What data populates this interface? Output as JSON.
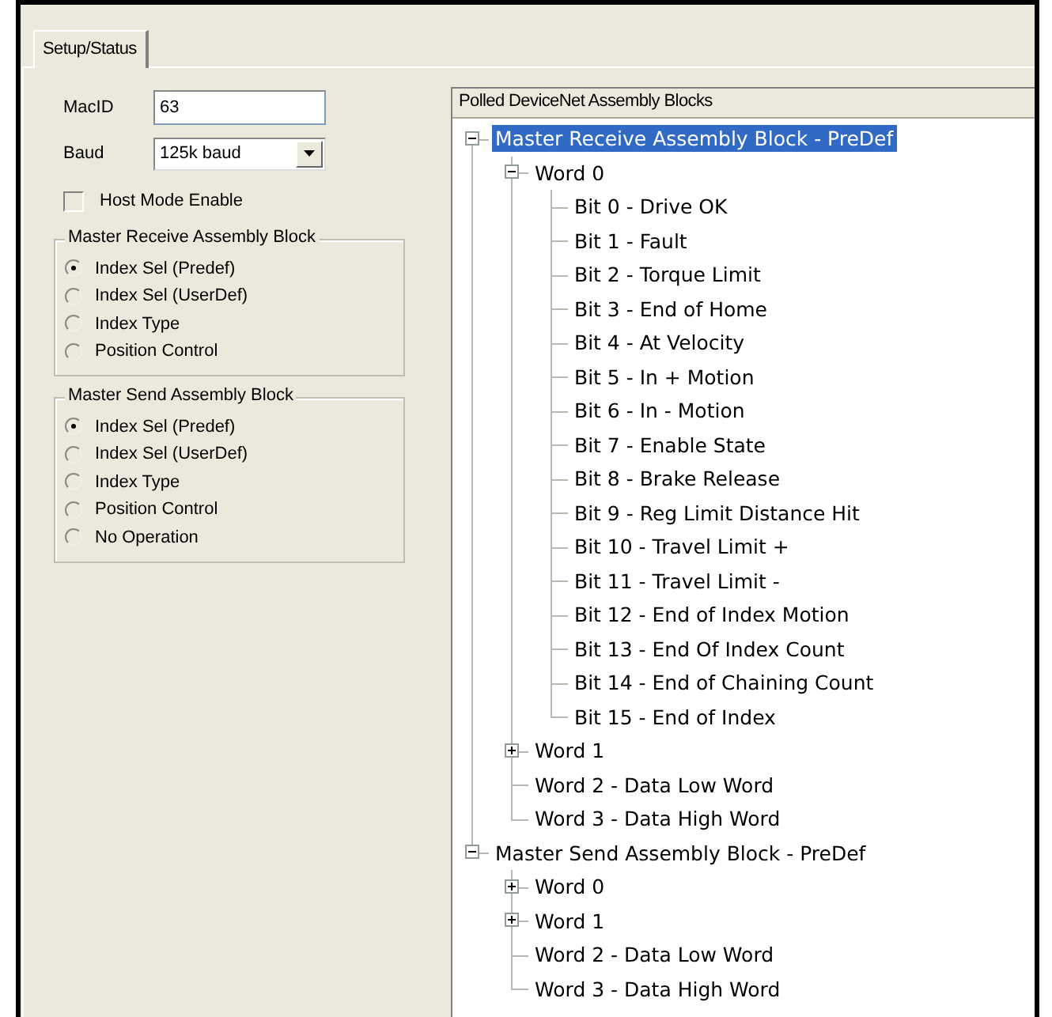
{
  "tabs": [
    {
      "label": "Setup/Status",
      "selected": true
    }
  ],
  "macid": {
    "label": "MacID",
    "value": "63"
  },
  "baud": {
    "label": "Baud",
    "value": "125k baud"
  },
  "host_mode": {
    "label": "Host Mode Enable",
    "checked": false
  },
  "groups": [
    {
      "title": "Master Receive Assembly Block",
      "options": [
        {
          "label": "Index Sel (Predef)",
          "selected": true
        },
        {
          "label": "Index Sel (UserDef)",
          "selected": false
        },
        {
          "label": "Index Type",
          "selected": false
        },
        {
          "label": "Position Control",
          "selected": false
        }
      ]
    },
    {
      "title": "Master Send Assembly Block",
      "options": [
        {
          "label": "Index Sel (Predef)",
          "selected": true
        },
        {
          "label": "Index Sel (UserDef)",
          "selected": false
        },
        {
          "label": "Index Type",
          "selected": false
        },
        {
          "label": "Position Control",
          "selected": false
        },
        {
          "label": "No Operation",
          "selected": false
        }
      ]
    }
  ],
  "tree": {
    "header": "Polled DeviceNet Assembly Blocks",
    "nodes": [
      {
        "kind": "folder",
        "label": "Master Receive Assembly Block - PreDef",
        "expanded": true,
        "selected": true,
        "children": [
          {
            "kind": "folder",
            "label": "Word 0",
            "expanded": true,
            "selected": false,
            "children": [
              {
                "kind": "leaf",
                "label": "Bit 0 - Drive OK",
                "selected": false
              },
              {
                "kind": "leaf",
                "label": "Bit 1 - Fault",
                "selected": false
              },
              {
                "kind": "leaf",
                "label": "Bit 2 - Torque Limit",
                "selected": false
              },
              {
                "kind": "leaf",
                "label": "Bit 3 - End of Home",
                "selected": false
              },
              {
                "kind": "leaf",
                "label": "Bit 4 - At Velocity",
                "selected": false
              },
              {
                "kind": "leaf",
                "label": "Bit 5 - In + Motion",
                "selected": false
              },
              {
                "kind": "leaf",
                "label": "Bit 6 - In - Motion",
                "selected": false
              },
              {
                "kind": "leaf",
                "label": "Bit 7 - Enable State",
                "selected": false
              },
              {
                "kind": "leaf",
                "label": "Bit 8 - Brake Release",
                "selected": false
              },
              {
                "kind": "leaf",
                "label": "Bit 9 - Reg Limit Distance Hit",
                "selected": false
              },
              {
                "kind": "leaf",
                "label": "Bit 10 - Travel Limit +",
                "selected": false
              },
              {
                "kind": "leaf",
                "label": "Bit 11 - Travel Limit -",
                "selected": false
              },
              {
                "kind": "leaf",
                "label": "Bit 12 - End of Index Motion",
                "selected": false
              },
              {
                "kind": "leaf",
                "label": "Bit 13 - End Of Index Count",
                "selected": false
              },
              {
                "kind": "leaf",
                "label": "Bit 14 - End of Chaining Count",
                "selected": false
              },
              {
                "kind": "leaf",
                "label": "Bit 15 - End of Index",
                "selected": false
              }
            ]
          },
          {
            "kind": "folder",
            "label": "Word 1",
            "expanded": false,
            "selected": false
          },
          {
            "kind": "leaf",
            "label": "Word 2 - Data Low Word",
            "selected": false
          },
          {
            "kind": "leaf",
            "label": "Word 3 - Data High Word",
            "selected": false
          }
        ]
      },
      {
        "kind": "folder",
        "label": "Master Send Assembly Block - PreDef",
        "expanded": true,
        "selected": false,
        "children": [
          {
            "kind": "folder",
            "label": "Word 0",
            "expanded": false,
            "selected": false
          },
          {
            "kind": "folder",
            "label": "Word 1",
            "expanded": false,
            "selected": false
          },
          {
            "kind": "leaf",
            "label": "Word 2 - Data Low Word",
            "selected": false
          },
          {
            "kind": "leaf",
            "label": "Word 3 - Data High Word",
            "selected": false
          }
        ]
      }
    ]
  }
}
